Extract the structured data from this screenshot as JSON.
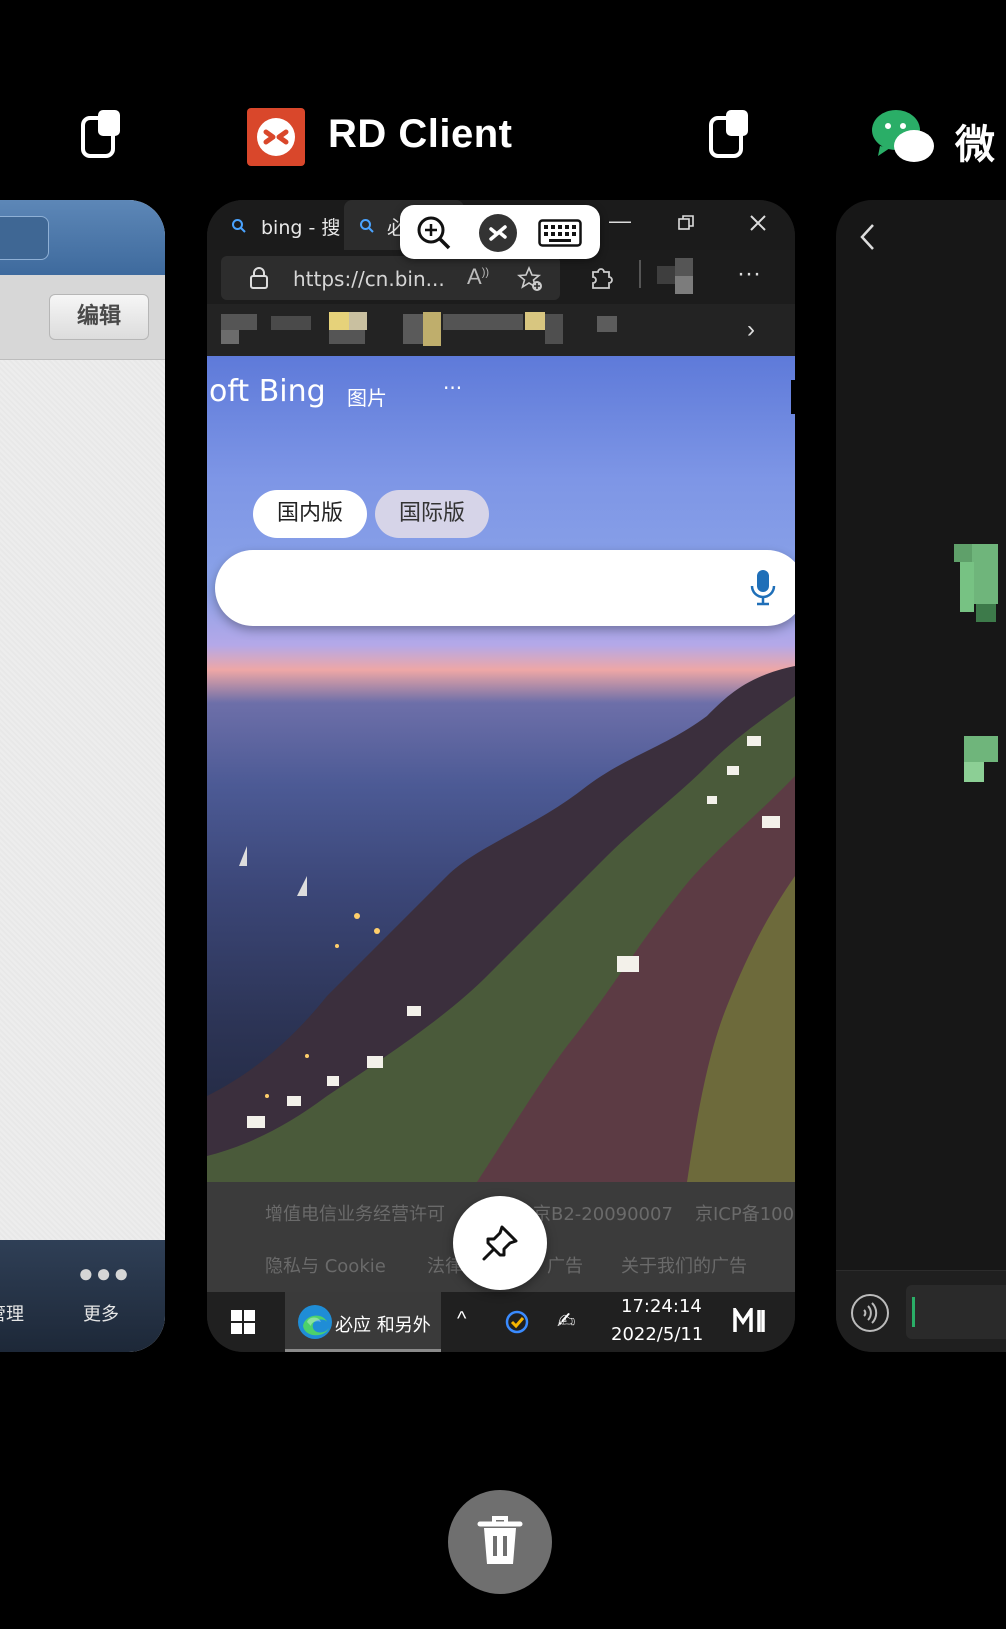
{
  "header": {
    "center_app_title": "RD Client",
    "right_app_title_partial": "微"
  },
  "left_card": {
    "edit_button": "编辑",
    "bottom_item_partial": "管理",
    "more_label": "更多"
  },
  "center_card": {
    "tabs": [
      "bing - 搜",
      "必"
    ],
    "url": "https://cn.bin...",
    "bing": {
      "logo_partial": "oft Bing",
      "nav_images": "图片",
      "nav_more": "···",
      "region_cn": "国内版",
      "region_intl": "国际版"
    },
    "footer": {
      "license_left": "增值电信业务经营许可",
      "license_right": "京B2-20090007",
      "icp": "京ICP备100",
      "privacy": "隐私与 Cookie",
      "legal": "法律",
      "ads": "广告",
      "about_ads": "关于我们的广告"
    },
    "taskbar": {
      "edge_label": "必应 和另外",
      "time": "17:24:14",
      "date": "2022/5/11"
    }
  },
  "colors": {
    "rd_red": "#d9472b",
    "wechat_green": "#2aae67"
  },
  "icons": [
    "split-screen-icon",
    "rd-client-logo-icon",
    "wechat-logo-icon",
    "pin-icon",
    "trash-icon"
  ]
}
